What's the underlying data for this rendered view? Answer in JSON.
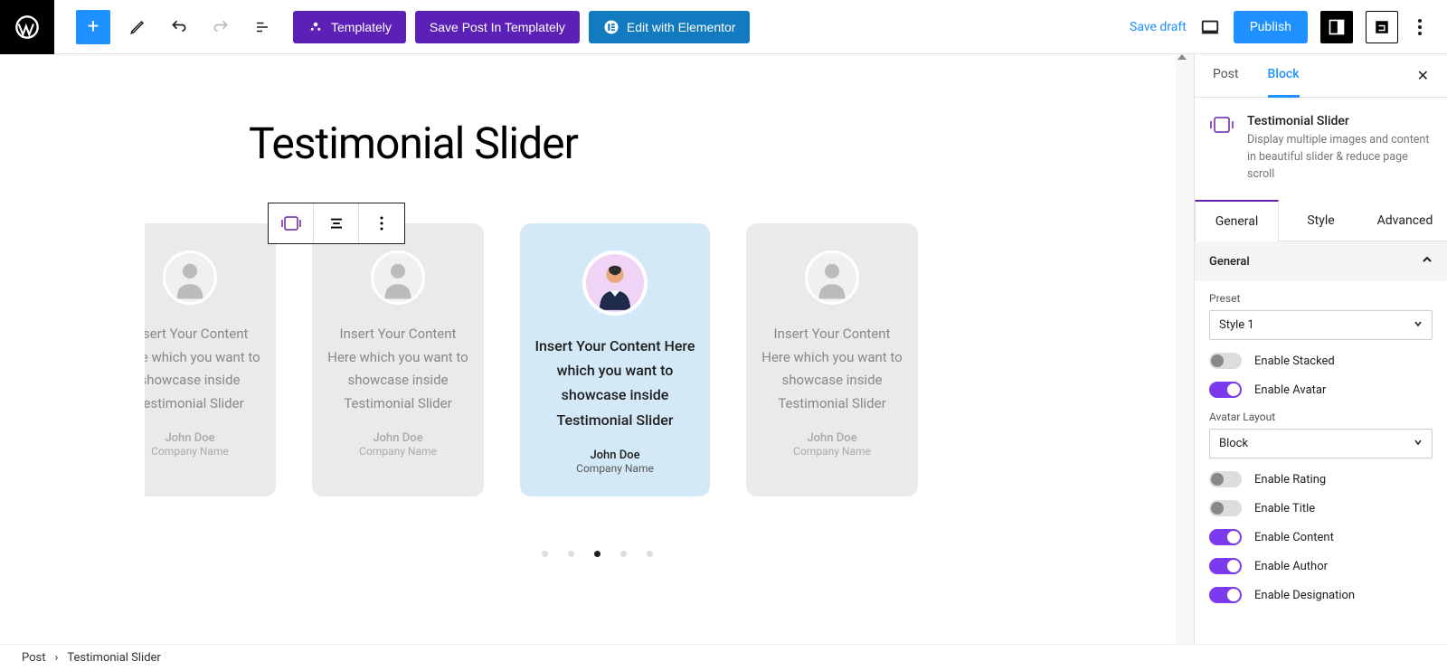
{
  "topbar": {
    "templately": "Templately",
    "savePostInTemplately": "Save Post In Templately",
    "editWithElementor": "Edit with Elementor",
    "saveDraft": "Save draft",
    "publish": "Publish"
  },
  "editor": {
    "pageTitle": "Testimonial Slider",
    "cardContent": "Insert Your Content Here which you want to showcase inside Testimonial Slider",
    "author": "John Doe",
    "company": "Company Name"
  },
  "sidebar": {
    "tabPost": "Post",
    "tabBlock": "Block",
    "blockTitle": "Testimonial Slider",
    "blockDesc": "Display multiple images and content in beautiful slider & reduce page scroll",
    "subTabs": {
      "general": "General",
      "style": "Style",
      "advanced": "Advanced"
    },
    "panel": {
      "head": "General",
      "presetLabel": "Preset",
      "presetValue": "Style 1",
      "enableStacked": "Enable Stacked",
      "enableAvatar": "Enable Avatar",
      "avatarLayoutLabel": "Avatar Layout",
      "avatarLayoutValue": "Block",
      "enableRating": "Enable Rating",
      "enableTitle": "Enable Title",
      "enableContent": "Enable Content",
      "enableAuthor": "Enable Author",
      "enableDesignation": "Enable Designation"
    }
  },
  "breadcrumb": {
    "post": "Post",
    "current": "Testimonial Slider"
  }
}
